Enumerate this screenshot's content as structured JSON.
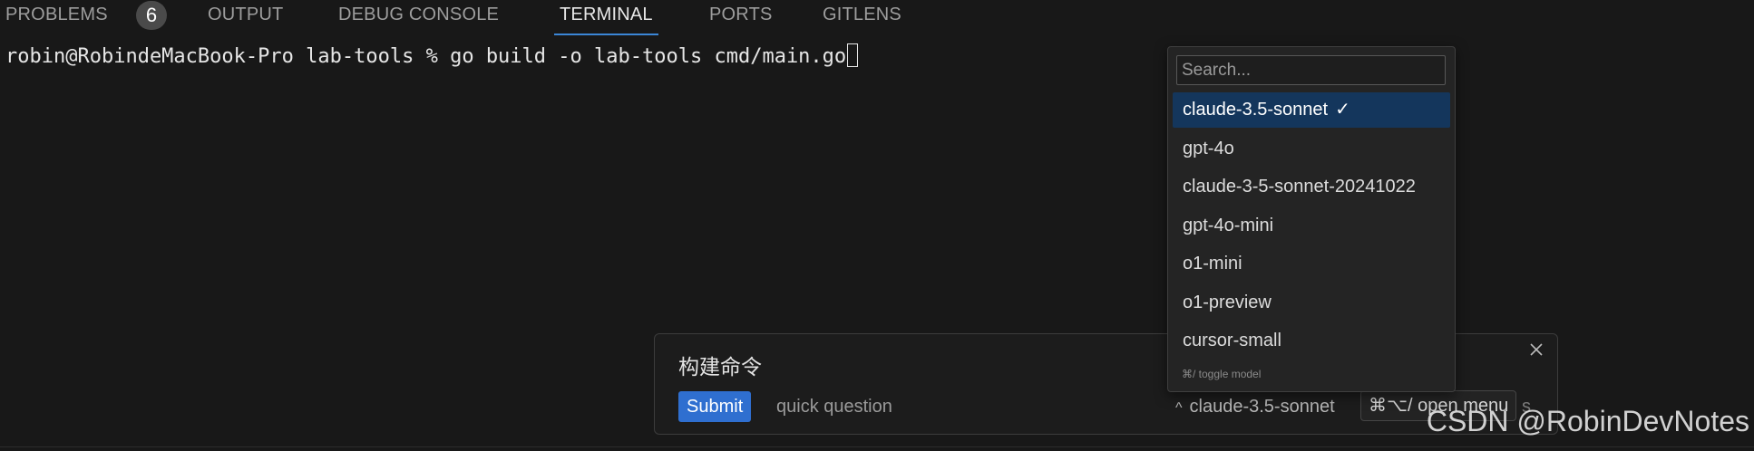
{
  "tabs": {
    "problems": "PROBLEMS",
    "problems_count": "6",
    "output": "OUTPUT",
    "debug_console": "DEBUG CONSOLE",
    "terminal": "TERMINAL",
    "ports": "PORTS",
    "gitlens": "GITLENS",
    "active": "TERMINAL"
  },
  "terminal": {
    "prompt": "robin@RobindeMacBook-Pro lab-tools % ",
    "command": "go build -o lab-tools cmd/main.go"
  },
  "model_menu": {
    "search_placeholder": "Search...",
    "items": [
      "claude-3.5-sonnet",
      "gpt-4o",
      "claude-3-5-sonnet-20241022",
      "gpt-4o-mini",
      "o1-mini",
      "o1-preview",
      "cursor-small"
    ],
    "selected": "claude-3.5-sonnet",
    "check_mark": "✓",
    "footer_hint": "⌘/ toggle model"
  },
  "prompt_box": {
    "text": "构建命令",
    "submit_label": "Submit",
    "quick_question": "quick question",
    "current_model": "claude-3.5-sonnet",
    "chevron": "^",
    "open_menu_hint": "⌘⌥/ open menu",
    "tail_char": "s"
  },
  "watermark": "CSDN @RobinDevNotes",
  "colors": {
    "background": "#181818",
    "accent": "#2f6fd0",
    "selected_item": "#14365c"
  }
}
